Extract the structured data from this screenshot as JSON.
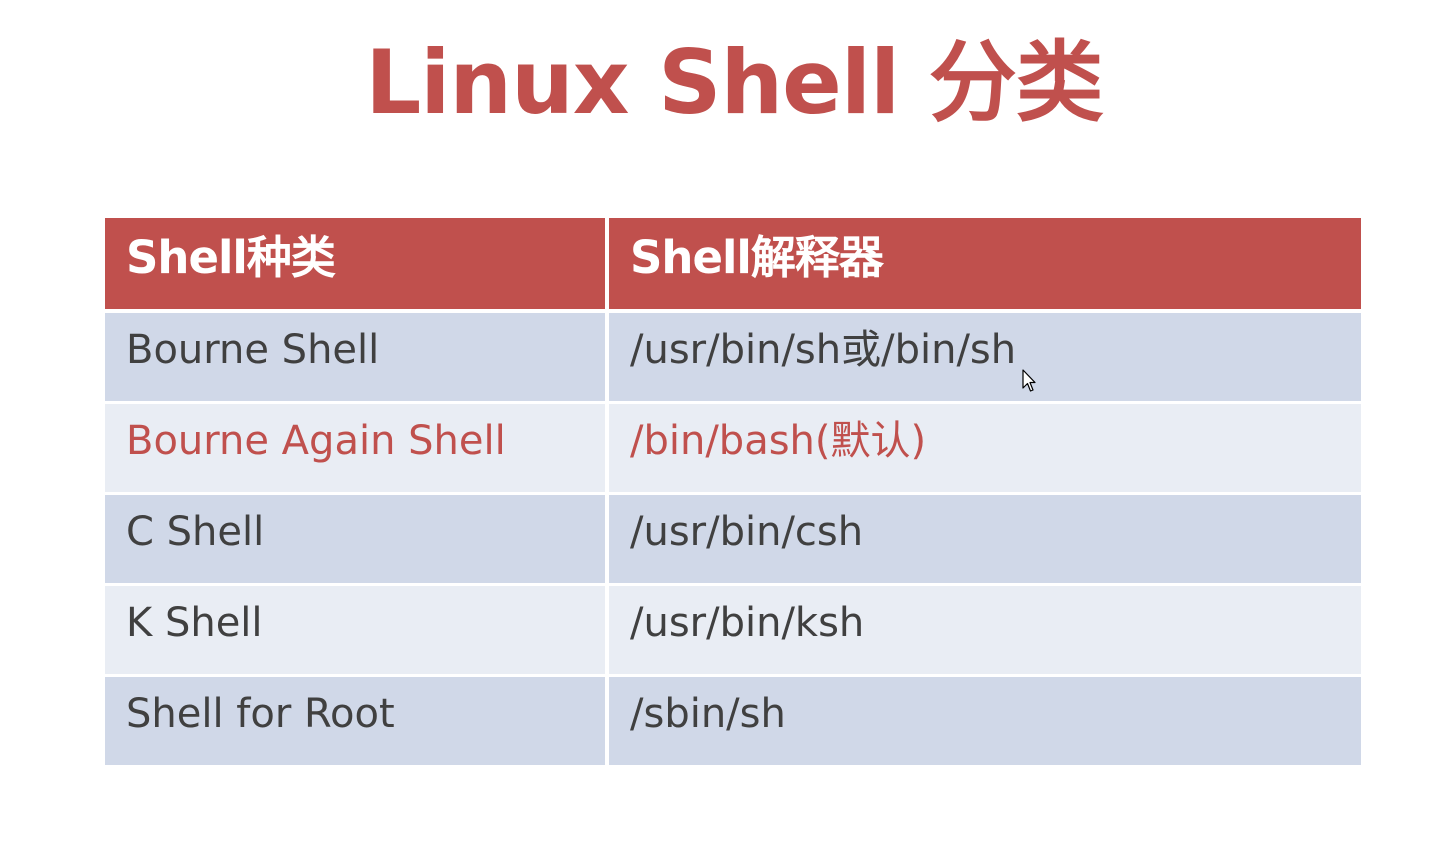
{
  "slide": {
    "title": "Linux Shell 分类"
  },
  "colors": {
    "accent": "#c0504d",
    "text": "#404040",
    "row_odd": "#d0d8e8",
    "row_even": "#e9edf4",
    "header_bg": "#c0504d"
  },
  "table": {
    "headers": [
      "Shell种类",
      "Shell解释器"
    ],
    "rows": [
      {
        "type": "Bourne Shell",
        "interpreter": "/usr/bin/sh或/bin/sh",
        "highlight": false
      },
      {
        "type": "Bourne Again Shell",
        "interpreter": "/bin/bash(默认)",
        "highlight": true
      },
      {
        "type": "C Shell",
        "interpreter": "/usr/bin/csh",
        "highlight": false
      },
      {
        "type": "K Shell",
        "interpreter": "/usr/bin/ksh",
        "highlight": false
      },
      {
        "type": "Shell for Root",
        "interpreter": "/sbin/sh",
        "highlight": false
      }
    ]
  },
  "cursor": {
    "icon": "mouse-pointer-icon"
  }
}
